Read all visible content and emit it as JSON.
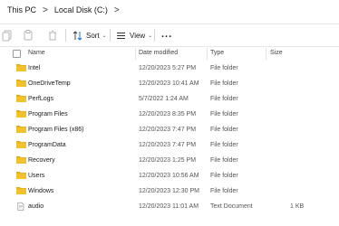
{
  "breadcrumb": {
    "items": [
      "This PC",
      "Local Disk (C:)"
    ],
    "separator": ">"
  },
  "toolbar": {
    "sort_label": "Sort",
    "view_label": "View",
    "more_label": "..."
  },
  "columns": {
    "name": "Name",
    "date": "Date modified",
    "type": "Type",
    "size": "Size"
  },
  "files": [
    {
      "name": "Intel",
      "date": "12/20/2023 5:27 PM",
      "type": "File folder",
      "size": "",
      "icon": "folder-icon"
    },
    {
      "name": "OneDriveTemp",
      "date": "12/20/2023 10:41 AM",
      "type": "File folder",
      "size": "",
      "icon": "folder-icon"
    },
    {
      "name": "PerfLogs",
      "date": "5/7/2022 1:24 AM",
      "type": "File folder",
      "size": "",
      "icon": "folder-icon"
    },
    {
      "name": "Program Files",
      "date": "12/20/2023 8:35 PM",
      "type": "File folder",
      "size": "",
      "icon": "folder-icon"
    },
    {
      "name": "Program Files (x86)",
      "date": "12/20/2023 7:47 PM",
      "type": "File folder",
      "size": "",
      "icon": "folder-icon"
    },
    {
      "name": "ProgramData",
      "date": "12/20/2023 7:47 PM",
      "type": "File folder",
      "size": "",
      "icon": "folder-icon"
    },
    {
      "name": "Recovery",
      "date": "12/20/2023 1:25 PM",
      "type": "File folder",
      "size": "",
      "icon": "folder-icon"
    },
    {
      "name": "Users",
      "date": "12/20/2023 10:56 AM",
      "type": "File folder",
      "size": "",
      "icon": "folder-icon"
    },
    {
      "name": "Windows",
      "date": "12/20/2023 12:30 PM",
      "type": "File folder",
      "size": "",
      "icon": "folder-icon"
    },
    {
      "name": "audio",
      "date": "12/20/2023 11:01 AM",
      "type": "Text Document",
      "size": "1 KB",
      "icon": "text-file-icon"
    }
  ],
  "colors": {
    "folder": "#f2c12e",
    "folder_dark": "#e0a81c",
    "accent": "#0067c0"
  }
}
